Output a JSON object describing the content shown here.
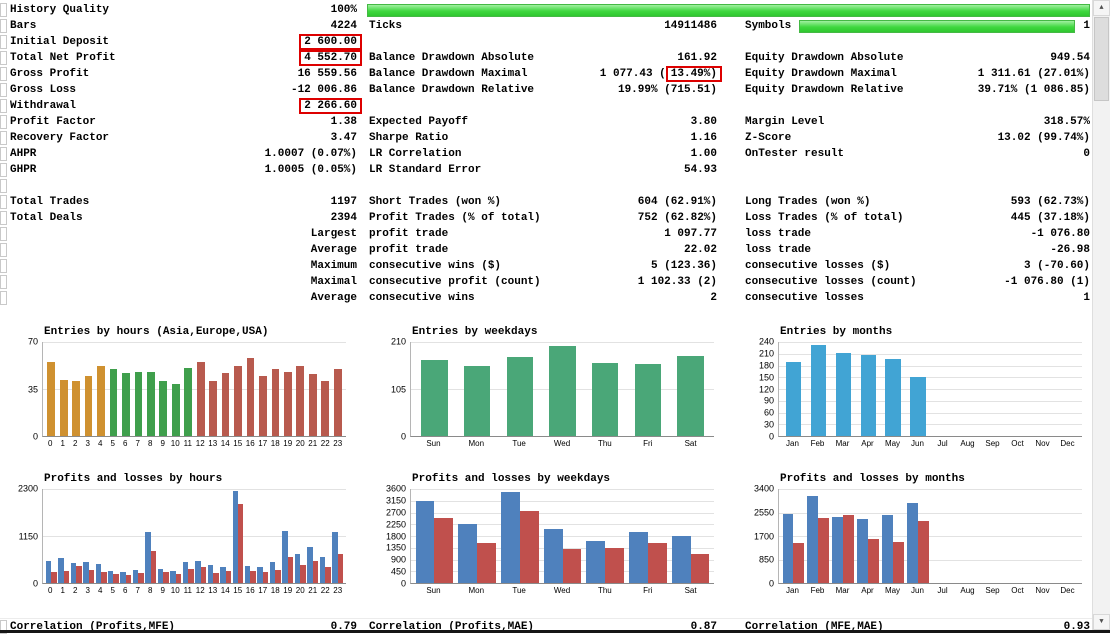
{
  "colors": {
    "quality_green": "#3fd83f",
    "highlight_red": "#dd0000",
    "profit_blue": "#4f81bd",
    "loss_red": "#c0504d",
    "entries_green": "#4aa778",
    "entries_blue": "#41a4d4",
    "asia_orange": "#cf9130",
    "europe_green": "#3f9f4c",
    "usa_red": "#b85a4e"
  },
  "scrollbar": {
    "up_icon": "▲",
    "down_icon": "▼"
  },
  "table": {
    "rows": [
      {
        "l1": "History Quality",
        "v1": "100%",
        "greenbar23": true
      },
      {
        "l1": "Bars",
        "v1": "4224",
        "l2": "Ticks",
        "v2": "14911486",
        "l3": "Symbols",
        "v3": "1",
        "greenbar3": true
      },
      {
        "l1": "Initial Deposit",
        "v1": "2 600.00",
        "box1": true
      },
      {
        "l1": "Total Net Profit",
        "v1": "4 552.70",
        "box1": true,
        "l2": "Balance Drawdown Absolute",
        "v2": "161.92",
        "l3": "Equity Drawdown Absolute",
        "v3": "949.54"
      },
      {
        "l1": "Gross Profit",
        "v1": "16 559.56",
        "l2": "Balance Drawdown Maximal",
        "v2pre": "1 077.43 (",
        "v2box": "13.49%)",
        "l3": "Equity Drawdown Maximal",
        "v3": "1 311.61 (27.01%)"
      },
      {
        "l1": "Gross Loss",
        "v1": "-12 006.86",
        "l2": "Balance Drawdown Relative",
        "v2": "19.99% (715.51)",
        "l3": "Equity Drawdown Relative",
        "v3": "39.71% (1 086.85)"
      },
      {
        "l1": "Withdrawal",
        "v1": "2 266.60",
        "box1": true
      },
      {
        "l1": "Profit Factor",
        "v1": "1.38",
        "l2": "Expected Payoff",
        "v2": "3.80",
        "l3": "Margin Level",
        "v3": "318.57%"
      },
      {
        "l1": "Recovery Factor",
        "v1": "3.47",
        "l2": "Sharpe Ratio",
        "v2": "1.16",
        "l3": "Z-Score",
        "v3": "13.02 (99.74%)"
      },
      {
        "l1": "AHPR",
        "v1": "1.0007 (0.07%)",
        "l2": "LR Correlation",
        "v2": "1.00",
        "l3": "OnTester result",
        "v3": "0"
      },
      {
        "l1": "GHPR",
        "v1": "1.0005 (0.05%)",
        "l2": "LR Standard Error",
        "v2": "54.93"
      },
      {},
      {
        "l1": "Total Trades",
        "v1": "1197",
        "l2": "Short Trades (won %)",
        "v2": "604 (62.91%)",
        "l3": "Long Trades (won %)",
        "v3": "593 (62.73%)"
      },
      {
        "l1": "Total Deals",
        "v1": "2394",
        "l2": "Profit Trades (% of total)",
        "v2": "752 (62.82%)",
        "l3": "Loss Trades (% of total)",
        "v3": "445 (37.18%)"
      },
      {
        "v1": "Largest",
        "l2": "profit trade",
        "v2": "1 097.77",
        "l3": "loss trade",
        "v3": "-1 076.80"
      },
      {
        "v1": "Average",
        "l2": "profit trade",
        "v2": "22.02",
        "l3": "loss trade",
        "v3": "-26.98"
      },
      {
        "v1": "Maximum",
        "l2": "consecutive wins ($)",
        "v2": "5 (123.36)",
        "l3": "consecutive losses ($)",
        "v3": "3 (-70.60)"
      },
      {
        "v1": "Maximal",
        "l2": "consecutive profit (count)",
        "v2": "1 102.33 (2)",
        "l3": "consecutive losses (count)",
        "v3": "-1 076.80 (1)"
      },
      {
        "v1": "Average",
        "l2": "consecutive wins",
        "v2": "2",
        "l3": "consecutive losses",
        "v3": "1"
      }
    ]
  },
  "footer": {
    "rows": [
      {
        "l1": "Correlation (Profits,MFE)",
        "v1": "0.79",
        "l2": "Correlation (Profits,MAE)",
        "v2": "0.87",
        "l3": "Correlation (MFE,MAE)",
        "v3": "0.93"
      }
    ]
  },
  "chart_data": [
    {
      "id": "entries-by-hours",
      "row": 1,
      "type": "bar",
      "title": "Entries by hours (Asia,Europe,USA)",
      "ymax": 70,
      "yticks": [
        70,
        35,
        0
      ],
      "categories": [
        "0",
        "1",
        "2",
        "3",
        "4",
        "5",
        "6",
        "7",
        "8",
        "9",
        "10",
        "11",
        "12",
        "13",
        "14",
        "15",
        "16",
        "17",
        "18",
        "19",
        "20",
        "21",
        "22",
        "23"
      ],
      "values": [
        55,
        42,
        41,
        45,
        52,
        50,
        47,
        48,
        48,
        41,
        39,
        51,
        55,
        41,
        47,
        52,
        58,
        45,
        50,
        48,
        52,
        46,
        41,
        50
      ],
      "color_ranges": [
        {
          "from": 0,
          "to": 4,
          "color": "#cf9130"
        },
        {
          "from": 5,
          "to": 11,
          "color": "#3f9f4c"
        },
        {
          "from": 12,
          "to": 23,
          "color": "#b85a4e"
        }
      ]
    },
    {
      "id": "entries-by-weekdays",
      "row": 1,
      "type": "bar",
      "title": "Entries by weekdays",
      "ymax": 210,
      "yticks": [
        210,
        105,
        0
      ],
      "categories": [
        "Sun",
        "Mon",
        "Tue",
        "Wed",
        "Thu",
        "Fri",
        "Sat"
      ],
      "values": [
        170,
        157,
        177,
        202,
        163,
        160,
        178
      ],
      "color": "#4aa778"
    },
    {
      "id": "entries-by-months",
      "row": 1,
      "type": "bar",
      "title": "Entries by months",
      "ymax": 240,
      "yticks": [
        240,
        210,
        180,
        150,
        120,
        90,
        60,
        30,
        0
      ],
      "categories": [
        "Jan",
        "Feb",
        "Mar",
        "Apr",
        "May",
        "Jun",
        "Jul",
        "Aug",
        "Sep",
        "Oct",
        "Nov",
        "Dec"
      ],
      "values": [
        190,
        232,
        212,
        206,
        196,
        150,
        0,
        0,
        0,
        0,
        0,
        0
      ],
      "color": "#41a4d4"
    },
    {
      "id": "pl-by-hours",
      "row": 2,
      "type": "bar",
      "title": "Profits and losses by hours",
      "ymax": 2300,
      "yticks": [
        2300,
        1150,
        0
      ],
      "categories": [
        "0",
        "1",
        "2",
        "3",
        "4",
        "5",
        "6",
        "7",
        "8",
        "9",
        "10",
        "11",
        "12",
        "13",
        "14",
        "15",
        "16",
        "17",
        "18",
        "19",
        "20",
        "21",
        "22",
        "23"
      ],
      "series": [
        {
          "name": "profit",
          "color": "#4f81bd",
          "values": [
            550,
            620,
            480,
            520,
            470,
            300,
            260,
            310,
            1250,
            340,
            290,
            520,
            540,
            430,
            390,
            2260,
            420,
            390,
            520,
            1280,
            700,
            880,
            640,
            1250
          ]
        },
        {
          "name": "loss",
          "color": "#c0504d",
          "values": [
            280,
            300,
            420,
            310,
            260,
            230,
            190,
            240,
            780,
            260,
            210,
            350,
            390,
            250,
            300,
            1940,
            300,
            280,
            330,
            640,
            450,
            540,
            400,
            700
          ]
        }
      ]
    },
    {
      "id": "pl-by-weekdays",
      "row": 2,
      "type": "bar",
      "title": "Profits and losses by weekdays",
      "ymax": 3600,
      "yticks": [
        3600,
        3150,
        2700,
        2250,
        1800,
        1350,
        900,
        450,
        0
      ],
      "categories": [
        "Sun",
        "Mon",
        "Tue",
        "Wed",
        "Thu",
        "Fri",
        "Sat"
      ],
      "series": [
        {
          "name": "profit",
          "color": "#4f81bd",
          "values": [
            3150,
            2250,
            3500,
            2050,
            1600,
            1950,
            1800
          ]
        },
        {
          "name": "loss",
          "color": "#c0504d",
          "values": [
            2500,
            1550,
            2750,
            1300,
            1350,
            1550,
            1100
          ]
        }
      ]
    },
    {
      "id": "pl-by-months",
      "row": 2,
      "type": "bar",
      "title": "Profits and losses by months",
      "ymax": 3400,
      "yticks": [
        3400,
        2550,
        1700,
        850,
        0
      ],
      "categories": [
        "Jan",
        "Feb",
        "Mar",
        "Apr",
        "May",
        "Jun",
        "Jul",
        "Aug",
        "Sep",
        "Oct",
        "Nov",
        "Dec"
      ],
      "series": [
        {
          "name": "profit",
          "color": "#4f81bd",
          "values": [
            2500,
            3150,
            2400,
            2300,
            2450,
            2900,
            0,
            0,
            0,
            0,
            0,
            0
          ]
        },
        {
          "name": "loss",
          "color": "#c0504d",
          "values": [
            1450,
            2350,
            2450,
            1600,
            1500,
            2250,
            0,
            0,
            0,
            0,
            0,
            0
          ]
        }
      ]
    }
  ]
}
